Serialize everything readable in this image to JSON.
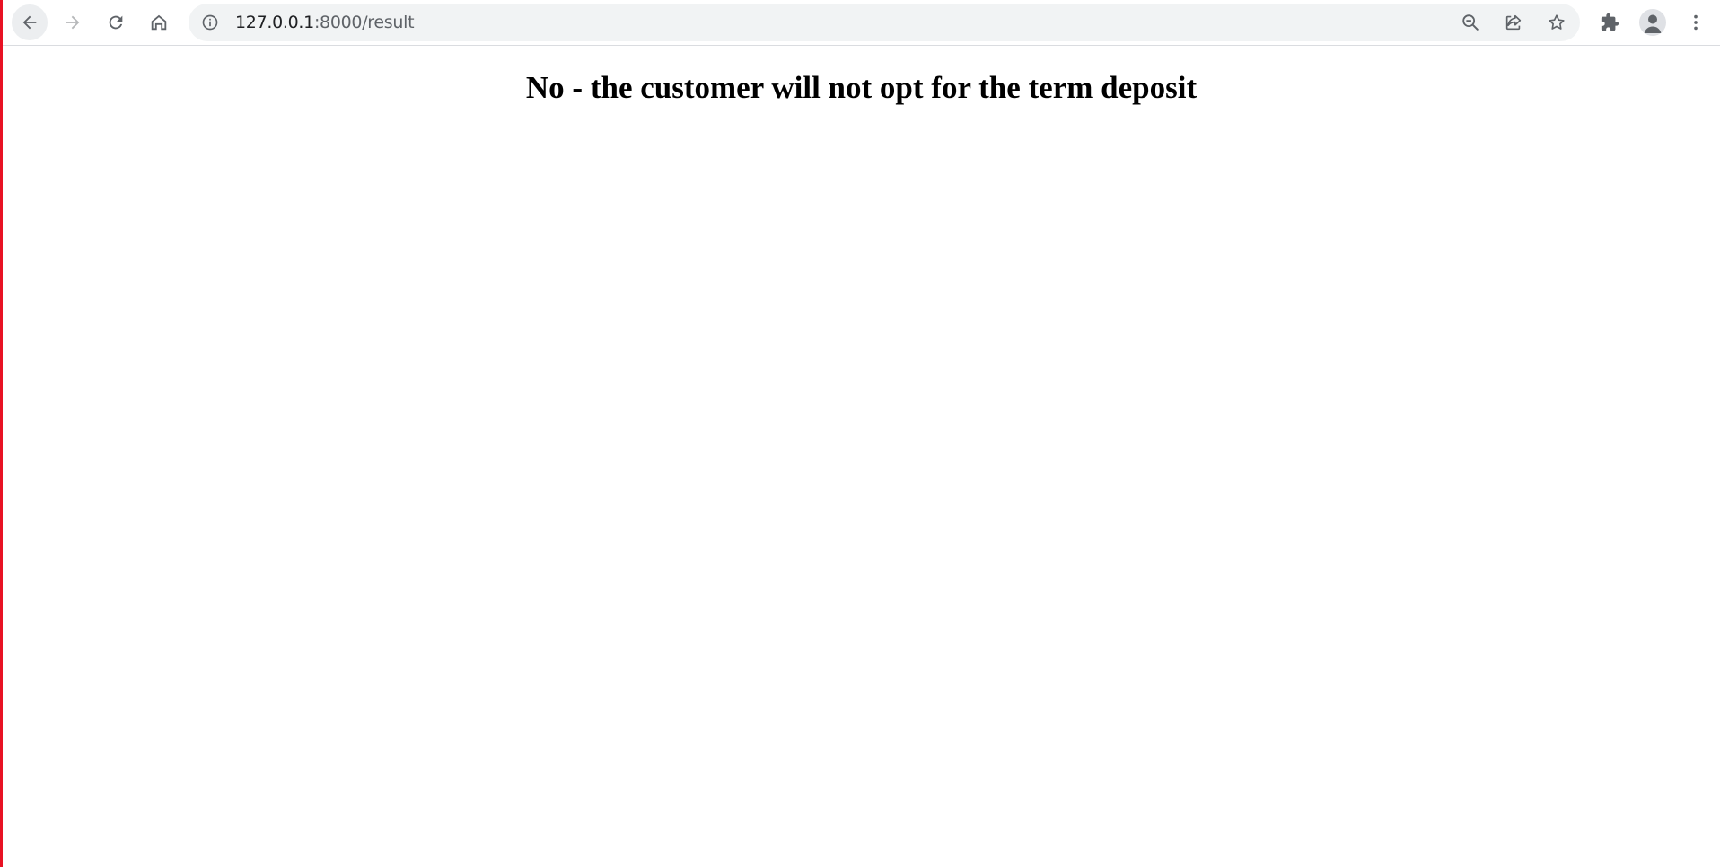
{
  "browser": {
    "url_host": "127.0.0.1",
    "url_path": ":8000/result",
    "icons": {
      "back": "arrow-left-icon",
      "forward": "arrow-right-icon",
      "reload": "reload-icon",
      "home": "home-icon",
      "site_info": "info-circle-icon",
      "zoom": "zoom-out-icon",
      "share": "share-icon",
      "bookmark": "star-icon",
      "extensions": "puzzle-icon",
      "profile": "avatar-icon",
      "menu": "kebab-menu-icon"
    },
    "colors": {
      "toolbar": "#ffffff",
      "omnibox": "#f1f3f4",
      "icon": "#5f6368",
      "left_edge": "#e81123"
    }
  },
  "page": {
    "heading": "No - the customer will not opt for the term deposit"
  }
}
